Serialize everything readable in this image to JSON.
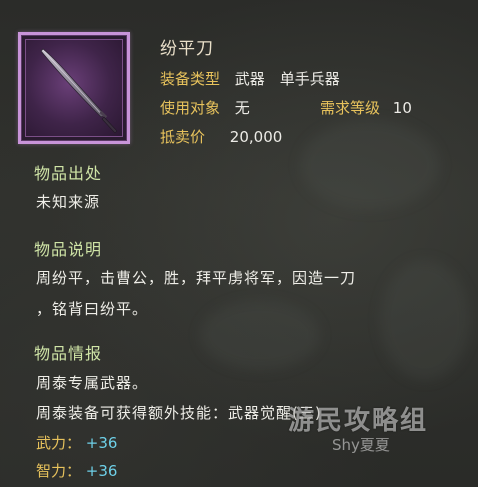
{
  "item": {
    "name": "纷平刀",
    "icon": "purple-curved-sword-icon",
    "frame_color": "#c894d9"
  },
  "attributes": {
    "equip_type_label": "装备类型",
    "equip_type_value": "武器　单手兵器",
    "user_label": "使用对象",
    "user_value": "无",
    "level_label": "需求等级",
    "level_value": "10",
    "price_label": "抵卖价",
    "price_value": "20,000"
  },
  "sections": {
    "origin_title": "物品出处",
    "origin_text": "未知来源",
    "desc_title": "物品说明",
    "desc_line1": "周纷平，击曹公，胜，拜平虏将军，因造一刀",
    "desc_line2": "，铭背曰纷平。",
    "info_title": "物品情报",
    "info_line1": "周泰专属武器。",
    "info_line2": "周泰装备可获得额外技能：武器觉醒(三)"
  },
  "stats": [
    {
      "label": "武力：",
      "value": "+36"
    },
    {
      "label": "智力：",
      "value": "+36"
    }
  ],
  "watermark": {
    "main": "游民攻略组",
    "sub": "Shy夏夏"
  },
  "colors": {
    "label_gold": "#e7c25c",
    "section_green": "#cfe4a6",
    "stat_cyan": "#6ed0e8",
    "text_white": "#efeee8"
  }
}
